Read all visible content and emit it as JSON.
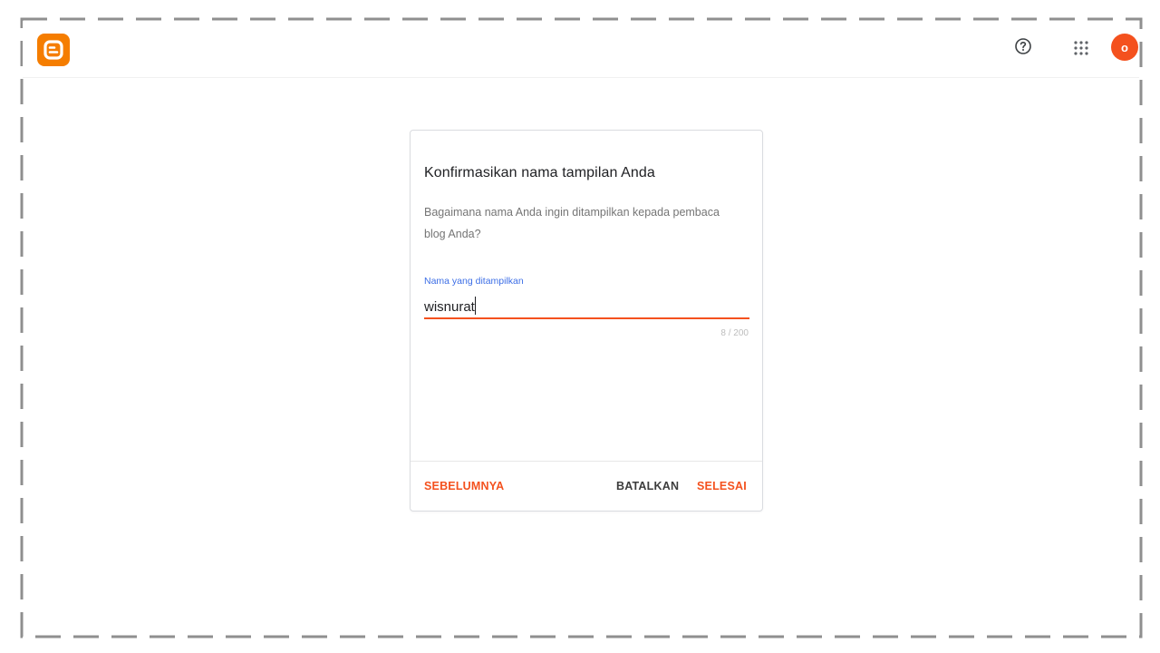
{
  "header": {
    "logo_icon": "blogger-logo-icon",
    "help_icon": "help-circle-icon",
    "apps_icon": "apps-grid-icon",
    "avatar_initial": "o",
    "brand_color": "#f57d00",
    "avatar_color": "#f4511e"
  },
  "dialog": {
    "title": "Konfirmasikan nama tampilan Anda",
    "description": "Bagaimana nama Anda ingin ditampilkan kepada pembaca blog Anda?",
    "field": {
      "label": "Nama yang ditampilkan",
      "value": "wisnurat",
      "counter": "8 / 200"
    },
    "buttons": {
      "previous": "SEBELUMNYA",
      "cancel": "BATALKAN",
      "done": "SELESAI"
    },
    "accent_color": "#f4511e"
  }
}
